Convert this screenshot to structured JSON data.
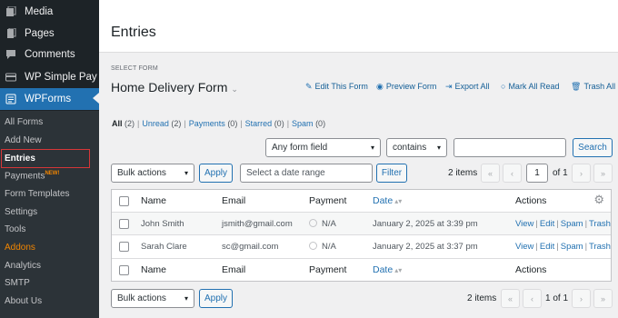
{
  "sidebar": {
    "top_items": [
      {
        "label": "Media",
        "icon": "media-icon"
      },
      {
        "label": "Pages",
        "icon": "pages-icon"
      },
      {
        "label": "Comments",
        "icon": "comments-icon"
      },
      {
        "label": "WP Simple Pay",
        "icon": "simple-pay-icon"
      },
      {
        "label": "WPForms",
        "icon": "wpforms-icon"
      }
    ],
    "submenu": [
      {
        "label": "All Forms"
      },
      {
        "label": "Add New"
      },
      {
        "label": "Entries"
      },
      {
        "label": "Payments",
        "badge": "NEW!"
      },
      {
        "label": "Form Templates"
      },
      {
        "label": "Settings"
      },
      {
        "label": "Tools"
      },
      {
        "label": "Addons"
      },
      {
        "label": "Analytics"
      },
      {
        "label": "SMTP"
      },
      {
        "label": "About Us"
      }
    ]
  },
  "header": {
    "title": "Entries"
  },
  "form_select": {
    "label": "SELECT FORM",
    "value": "Home Delivery Form"
  },
  "actions": {
    "edit": "Edit This Form",
    "preview": "Preview Form",
    "export": "Export All",
    "mark_read": "Mark All Read",
    "trash": "Trash All"
  },
  "filters": {
    "all": "All",
    "all_count": "(2)",
    "unread": "Unread",
    "unread_count": "(2)",
    "payments": "Payments",
    "payments_count": "(0)",
    "starred": "Starred",
    "starred_count": "(0)",
    "spam": "Spam",
    "spam_count": "(0)",
    "sep": "|"
  },
  "search": {
    "field_select": "Any form field",
    "operator_select": "contains",
    "input_value": "",
    "button": "Search"
  },
  "bulk": {
    "select": "Bulk actions",
    "apply": "Apply",
    "date_placeholder": "Select a date range",
    "filter": "Filter"
  },
  "pagination": {
    "items": "2 items",
    "current": "1",
    "of_total": "of 1",
    "first": "«",
    "prev": "‹",
    "next": "›",
    "last": "»",
    "bottom_text": "1 of 1"
  },
  "table": {
    "columns": {
      "name": "Name",
      "email": "Email",
      "payment": "Payment",
      "date": "Date",
      "actions": "Actions"
    },
    "rows": [
      {
        "name": "John Smith",
        "email": "jsmith@gmail.com",
        "payment": "N/A",
        "date": "January 2, 2025 at 3:39 pm"
      },
      {
        "name": "Sarah Clare",
        "email": "sc@gmail.com",
        "payment": "N/A",
        "date": "January 2, 2025 at 3:37 pm"
      }
    ],
    "row_actions": {
      "view": "View",
      "edit": "Edit",
      "spam": "Spam",
      "trash": "Trash",
      "sep": "|"
    }
  }
}
